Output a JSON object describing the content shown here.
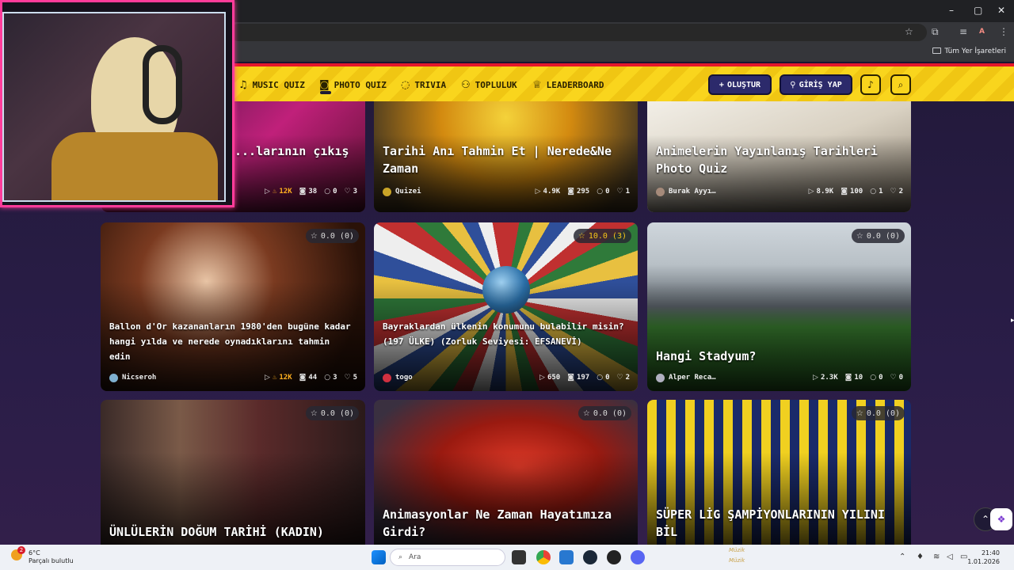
{
  "browser": {
    "bookmarks_label": "Tüm Yer İşaretleri",
    "icons": [
      "star-icon",
      "extension-icon",
      "media-icon",
      "profile-icon",
      "menu-icon"
    ],
    "profile_letter": "A"
  },
  "nav": {
    "items": [
      {
        "label": "MUSIC QUIZ",
        "icon": "music-icon"
      },
      {
        "label": "PHOTO QUIZ",
        "icon": "camera-icon"
      },
      {
        "label": "TRIVIA",
        "icon": "chat-icon"
      },
      {
        "label": "TOPLULUK",
        "icon": "users-icon"
      },
      {
        "label": "LEADERBOARD",
        "icon": "trophy-icon"
      }
    ],
    "create_label": "OLUŞTUR",
    "login_label": "GİRİŞ YAP"
  },
  "cards": [
    {
      "title": "...larının çıkış",
      "rating": "",
      "author": "",
      "stats": {
        "plays": "12K",
        "photos": "38",
        "comments": "0",
        "likes": "3"
      }
    },
    {
      "title": "Tarihi Anı Tahmin Et | Nerede&Ne Zaman",
      "rating": "",
      "author": "Quizei",
      "stats": {
        "plays": "4.9K",
        "photos": "295",
        "comments": "0",
        "likes": "1"
      }
    },
    {
      "title": "Animelerin Yayınlanış Tarihleri Photo Quiz",
      "rating": "",
      "author": "Burak Ayyı…",
      "stats": {
        "plays": "8.9K",
        "photos": "100",
        "comments": "1",
        "likes": "2"
      }
    },
    {
      "title": "Ballon d'Or kazananların 1980'den bugüne kadar hangi yılda ve nerede oynadıklarını tahmin edin",
      "rating": "0.0 (0)",
      "author": "Nicseroh",
      "stats": {
        "plays": "12K",
        "photos": "44",
        "comments": "3",
        "likes": "5"
      }
    },
    {
      "title": "Bayraklardan ülkenin konumunu bulabilir misin? (197 ÜLKE) (Zorluk Seviyesi: EFSANEVİ)",
      "rating": "10.0 (3)",
      "author": "togo",
      "stats": {
        "plays": "650",
        "photos": "197",
        "comments": "0",
        "likes": "2"
      }
    },
    {
      "title": "Hangi Stadyum?",
      "rating": "0.0 (0)",
      "author": "Alper Reca…",
      "stats": {
        "plays": "2.3K",
        "photos": "10",
        "comments": "0",
        "likes": "0"
      }
    },
    {
      "title": "ÜNLÜLERİN DOĞUM TARİHİ (KADIN)",
      "rating": "0.0 (0)",
      "author": "",
      "stats": {}
    },
    {
      "title": "Animasyonlar Ne Zaman Hayatımıza Girdi?",
      "rating": "0.0 (0)",
      "author": "",
      "stats": {}
    },
    {
      "title": "SÜPER LİG ŞAMPİYONLARININ YILINI BİL",
      "rating": "0.0 (0)",
      "author": "",
      "stats": {}
    }
  ],
  "taskbar": {
    "weather_temp": "6°C",
    "weather_desc": "Parçalı bulutlu",
    "search_placeholder": "Ara",
    "time": "21:40",
    "date": "1.01.2026",
    "notification_count": "2"
  }
}
